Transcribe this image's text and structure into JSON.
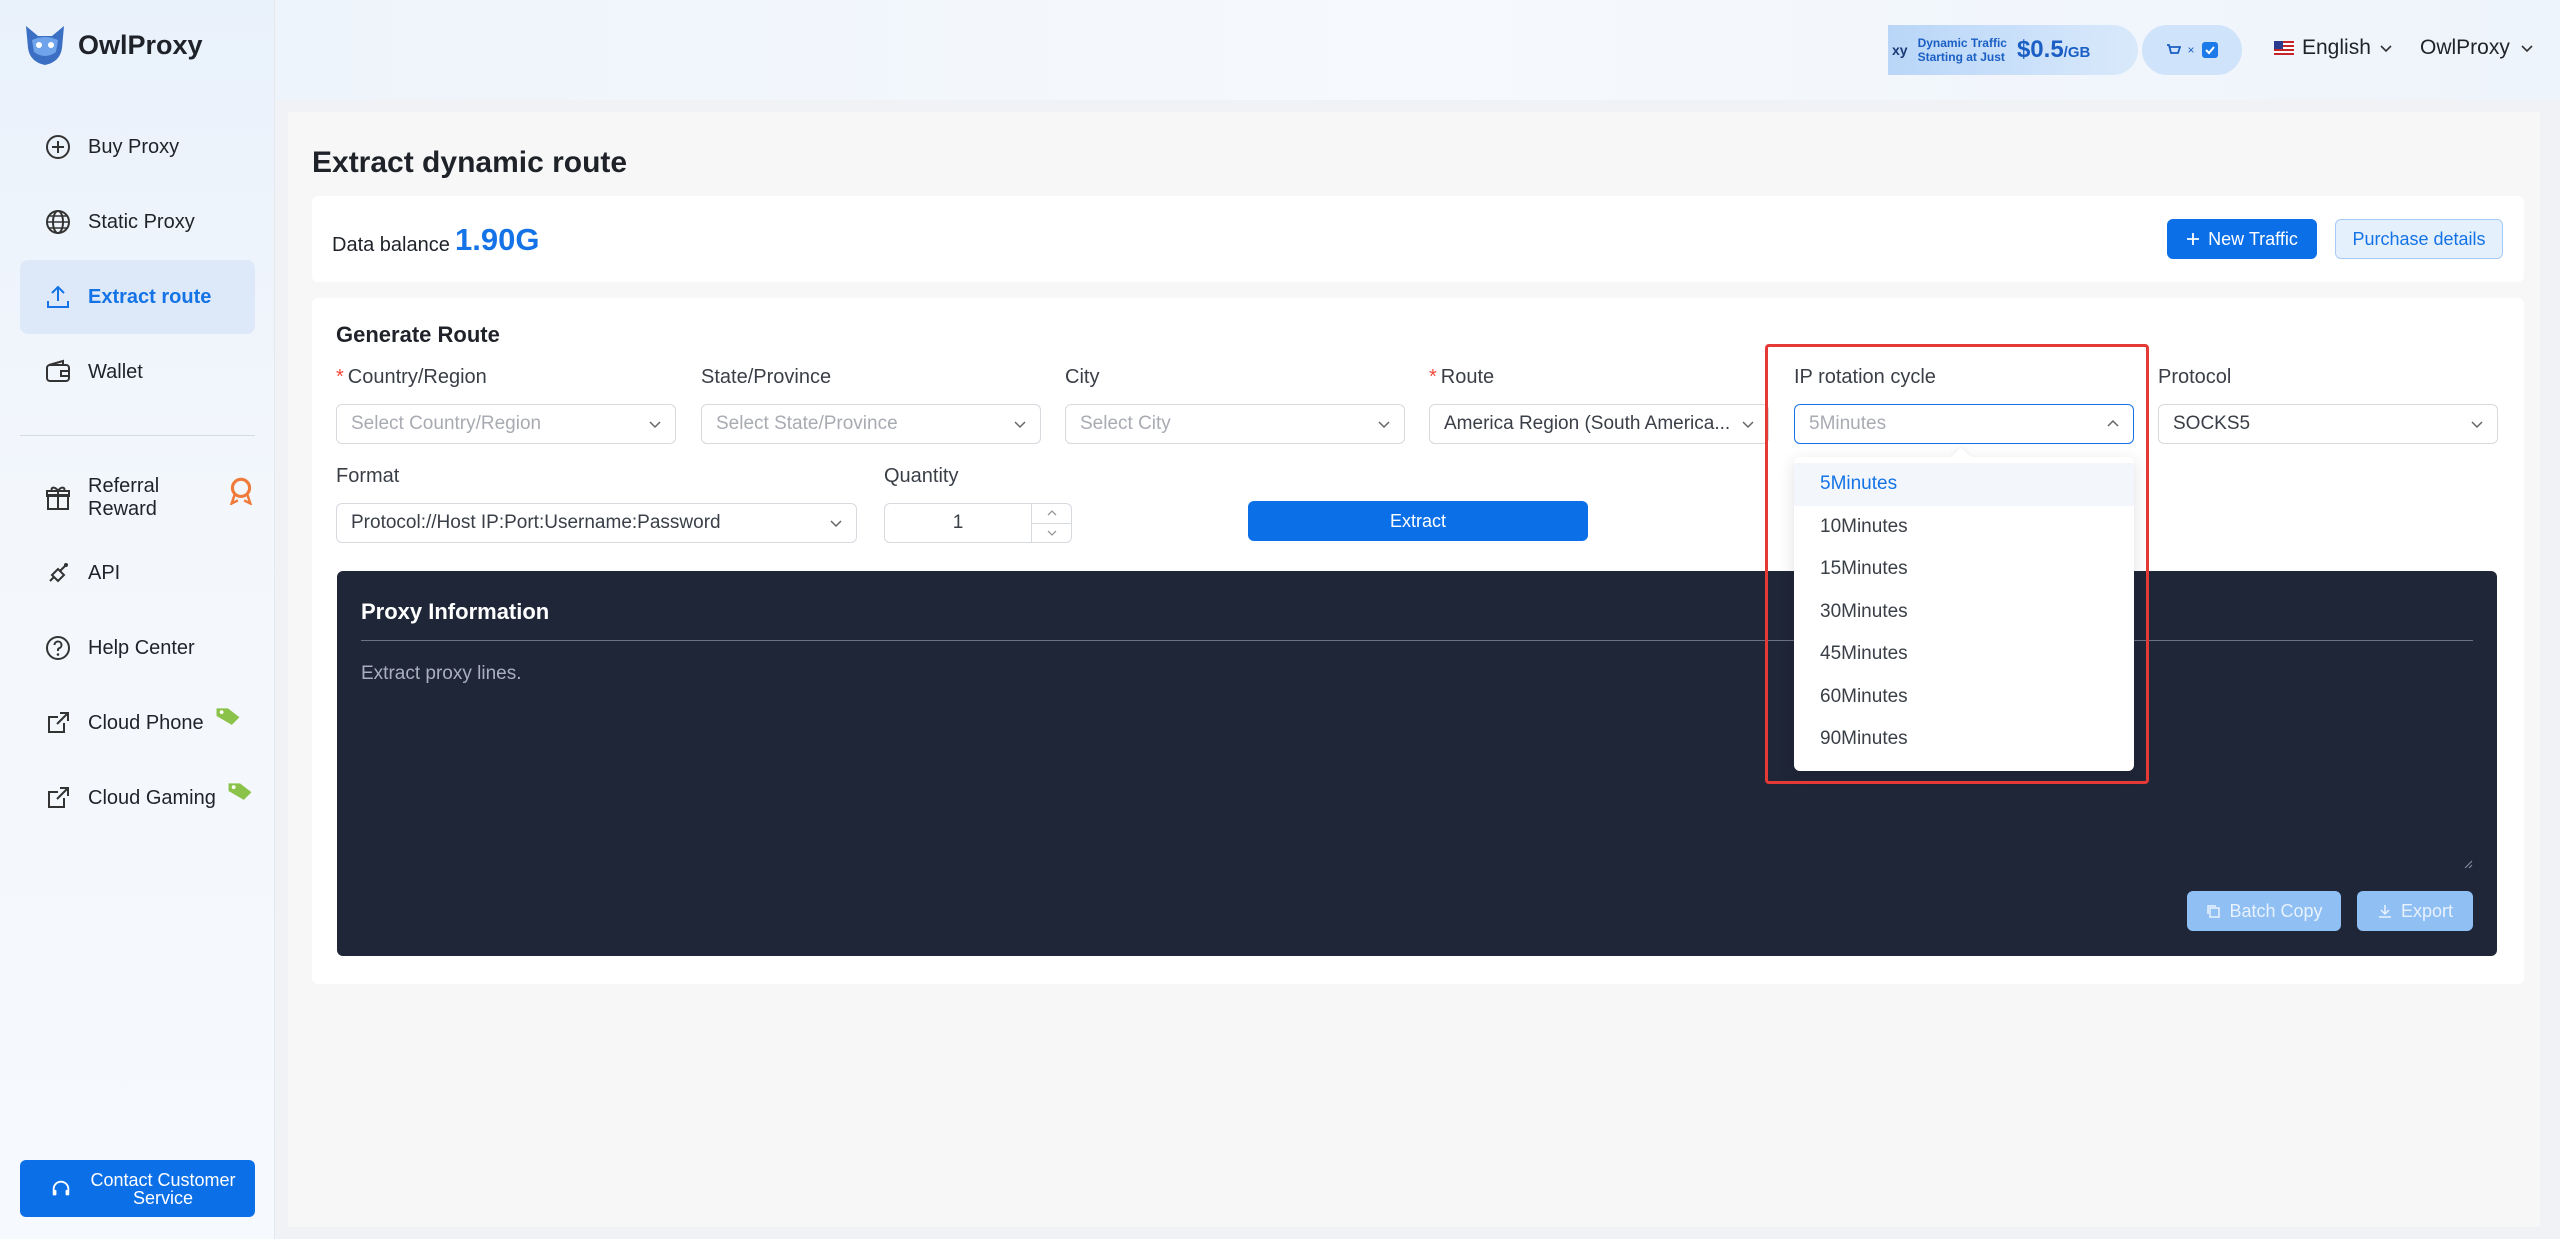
{
  "brand": {
    "name": "OwlProxy"
  },
  "sidebar": {
    "items": [
      {
        "label": "Buy Proxy",
        "icon": "plus-circle-icon"
      },
      {
        "label": "Static Proxy",
        "icon": "globe-icon"
      },
      {
        "label": "Extract route",
        "icon": "upload-icon",
        "active": true
      },
      {
        "label": "Wallet",
        "icon": "wallet-icon"
      },
      {
        "label": "Referral Reward",
        "icon": "gift-icon"
      },
      {
        "label": "API",
        "icon": "api-icon"
      },
      {
        "label": "Help Center",
        "icon": "question-circle-icon"
      },
      {
        "label": "Cloud Phone",
        "icon": "external-link-icon"
      },
      {
        "label": "Cloud Gaming",
        "icon": "external-link-icon"
      }
    ],
    "contact": "Contact Customer Service"
  },
  "header": {
    "promo_prefix": "xy",
    "promo_text_1": "Dynamic Traffic",
    "promo_text_2": "Starting at Just",
    "promo_price": "$0.5",
    "promo_unit": "/GB",
    "language": "English",
    "user": "OwlProxy"
  },
  "page": {
    "title": "Extract dynamic route",
    "balance_label": "Data balance",
    "balance_value": "1.90G",
    "new_traffic": "New Traffic",
    "purchase_details": "Purchase details"
  },
  "generate": {
    "title": "Generate Route",
    "country_label": "Country/Region",
    "country_placeholder": "Select Country/Region",
    "state_label": "State/Province",
    "state_placeholder": "Select State/Province",
    "city_label": "City",
    "city_placeholder": "Select City",
    "route_label": "Route",
    "route_value": "America Region (South America...",
    "rotation_label": "IP rotation cycle",
    "rotation_value": "5Minutes",
    "protocol_label": "Protocol",
    "protocol_value": "SOCKS5",
    "format_label": "Format",
    "format_value": "Protocol://Host IP:Port:Username:Password",
    "quantity_label": "Quantity",
    "quantity_value": "1",
    "extract": "Extract"
  },
  "proxy_info": {
    "title": "Proxy Information",
    "placeholder": "Extract proxy lines.",
    "batch_copy": "Batch Copy",
    "export": "Export"
  },
  "rotation_options": [
    "5Minutes",
    "10Minutes",
    "15Minutes",
    "30Minutes",
    "45Minutes",
    "60Minutes",
    "90Minutes"
  ],
  "colors": {
    "accent": "#0b6fe8",
    "panel": "#1f2638",
    "highlight": "#e53935"
  }
}
